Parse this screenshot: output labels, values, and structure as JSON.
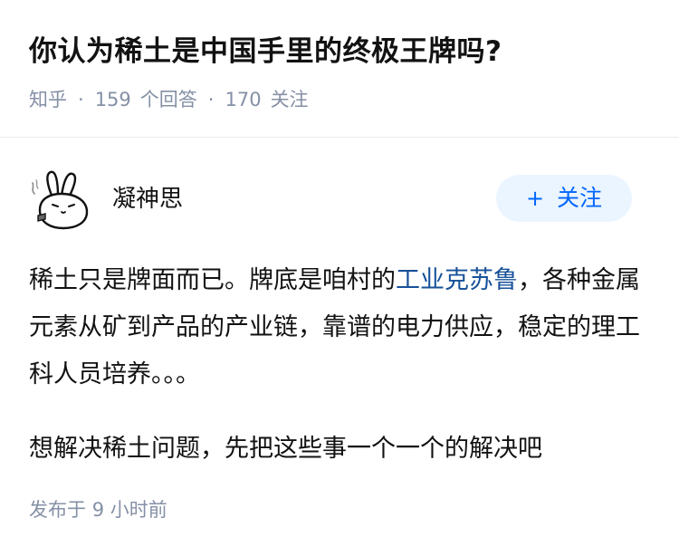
{
  "question": {
    "title": "你认为稀土是中国手里的终极王牌吗?",
    "source": "知乎",
    "separator": "·",
    "answer_count": "159",
    "answer_label": "个回答",
    "follower_count": "170",
    "follower_label": "关注"
  },
  "author": {
    "name": "凝神思",
    "avatar_icon": "rabbit-avatar-icon",
    "follow_plus": "+",
    "follow_label": "关注"
  },
  "answer": {
    "p1_before": "稀土只是牌面而已。牌底是咱村的",
    "p1_link": "工业克苏鲁",
    "p1_after": "，各种金属元素从矿到产品的产业链，靠谱的电力供应，稳定的理工科人员培养。。。",
    "p2": "想解决稀土问题，先把这些事一个一个的解决吧"
  },
  "footer": {
    "published_label": "发布于",
    "time_value": "9",
    "time_unit": "小时前"
  },
  "colors": {
    "meta": "#8590a6",
    "link": "#175199",
    "follow_bg": "#ebf5ff",
    "follow_text": "#0066ff"
  }
}
